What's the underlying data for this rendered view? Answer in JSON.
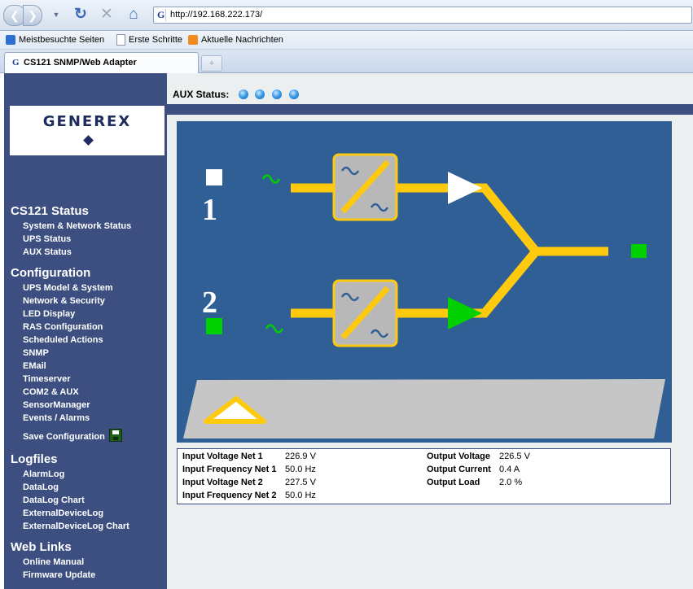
{
  "browser": {
    "url": "http://192.168.222.173/",
    "favicon_letter": "G",
    "bookmarks": [
      "Meistbesuchte Seiten",
      "Erste Schritte",
      "Aktuelle Nachrichten"
    ],
    "tab_title": "CS121 SNMP/Web Adapter",
    "new_tab_symbol": "+"
  },
  "logo": {
    "text": "GENEREX"
  },
  "aux_status": {
    "label": "AUX Status:",
    "led_color": "#3e9ee8"
  },
  "sidebar": {
    "sections": [
      {
        "title": "CS121 Status",
        "items": [
          "System & Network Status",
          "UPS Status",
          "AUX Status"
        ]
      },
      {
        "title": "Configuration",
        "items": [
          "UPS Model & System",
          "Network & Security",
          "LED Display",
          "RAS Configuration",
          "Scheduled Actions",
          "SNMP",
          "EMail",
          "Timeserver",
          "COM2 & AUX",
          "SensorManager",
          "Events / Alarms",
          "Save Configuration"
        ]
      },
      {
        "title": "Logfiles",
        "items": [
          "AlarmLog",
          "DataLog",
          "DataLog Chart",
          "ExternalDeviceLog",
          "ExternalDeviceLog Chart"
        ]
      },
      {
        "title": "Web Links",
        "items": [
          "Online Manual",
          "Firmware Update"
        ]
      }
    ]
  },
  "diagram": {
    "input1_label": "1",
    "input2_label": "2",
    "colors": {
      "background": "#2f5f94",
      "line": "#ffc90e",
      "ok": "#00d000",
      "off": "#ffffff"
    }
  },
  "measurements": {
    "left": [
      {
        "label": "Input Voltage Net 1",
        "value": "226.9 V"
      },
      {
        "label": "Input Frequency Net 1",
        "value": "50.0 Hz"
      },
      {
        "label": "Input Voltage Net 2",
        "value": "227.5 V"
      },
      {
        "label": "Input Frequency Net 2",
        "value": "50.0 Hz"
      }
    ],
    "right": [
      {
        "label": "Output Voltage",
        "value": "226.5 V"
      },
      {
        "label": "Output Current",
        "value": "0.4 A"
      },
      {
        "label": "Output Load",
        "value": "2.0 %"
      }
    ]
  }
}
